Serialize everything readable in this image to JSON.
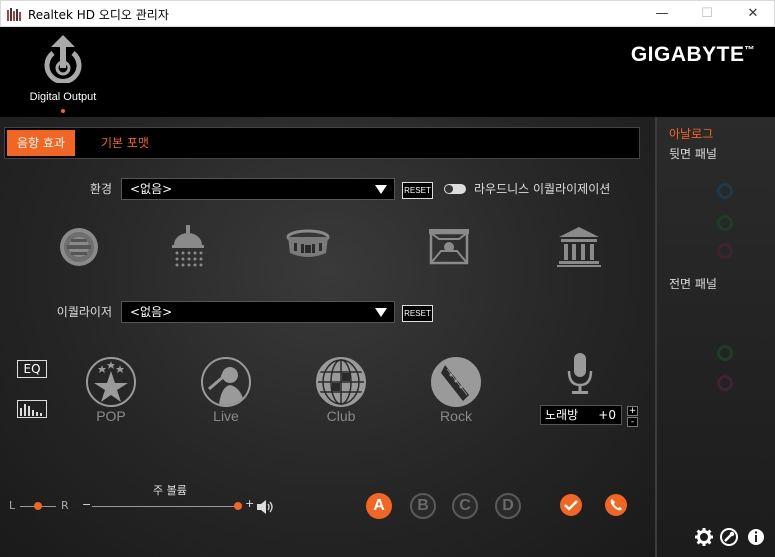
{
  "window": {
    "title": "Realtek HD 오디오 관리자",
    "minimize": "—",
    "maximize": "☐",
    "close": "✕"
  },
  "header": {
    "device_label": "Digital Output",
    "brand": "GIGABYTE",
    "brand_tm": "™"
  },
  "tabs": [
    {
      "label": "음향 효과",
      "active": true
    },
    {
      "label": "기본 포맷",
      "active": false
    }
  ],
  "environment": {
    "label": "환경",
    "value": "<없음>",
    "reset": "RESET",
    "loudness_label": "라우드니스 이퀄라이제이션",
    "loudness_on": false,
    "icons": [
      "stone-corridor-icon",
      "bathroom-shower-icon",
      "colosseum-icon",
      "stage-icon",
      "auditorium-icon"
    ]
  },
  "equalizer": {
    "label": "이퀄라이저",
    "value": "<없음>",
    "reset": "RESET",
    "eq_button": "EQ",
    "presets": [
      {
        "name": "POP",
        "icon": "stars-icon"
      },
      {
        "name": "Live",
        "icon": "singer-icon"
      },
      {
        "name": "Club",
        "icon": "disco-ball-icon"
      },
      {
        "name": "Rock",
        "icon": "guitar-icon"
      }
    ],
    "karaoke_label": "노래방",
    "karaoke_value": "+0",
    "plus": "+",
    "minus": "-"
  },
  "volume": {
    "label": "주 볼륨",
    "left": "L",
    "right": "R",
    "minus": "−",
    "plus": "+",
    "balance": 0.5,
    "level": 1.0
  },
  "bottom_buttons": {
    "a": "A",
    "b": "B",
    "c": "C",
    "d": "D"
  },
  "side_panel": {
    "analog_title": "아날로그",
    "back_panel": "뒷면 패널",
    "front_panel": "전면 패널"
  },
  "colors": {
    "accent": "#f26522",
    "jack_blue": "#1e3a4a",
    "jack_green": "#1f3d24",
    "jack_pink": "#3f2233"
  }
}
